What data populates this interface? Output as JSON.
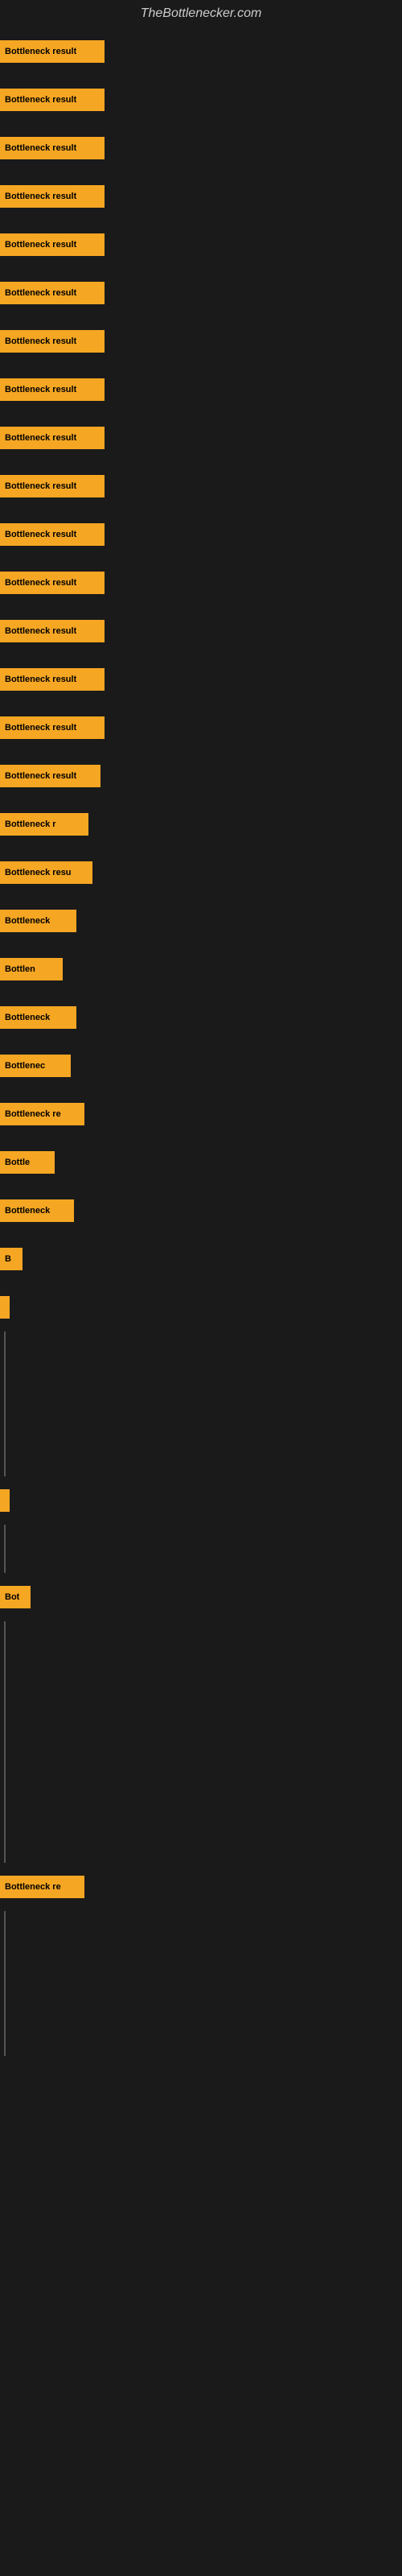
{
  "site": {
    "title": "TheBottlenecker.com"
  },
  "bars": [
    {
      "label": "Bottleneck result",
      "width": 130,
      "visible": true
    },
    {
      "label": "Bottleneck result",
      "width": 130,
      "visible": true
    },
    {
      "label": "Bottleneck result",
      "width": 130,
      "visible": true
    },
    {
      "label": "Bottleneck result",
      "width": 130,
      "visible": true
    },
    {
      "label": "Bottleneck result",
      "width": 130,
      "visible": true
    },
    {
      "label": "Bottleneck result",
      "width": 130,
      "visible": true
    },
    {
      "label": "Bottleneck result",
      "width": 130,
      "visible": true
    },
    {
      "label": "Bottleneck result",
      "width": 130,
      "visible": true
    },
    {
      "label": "Bottleneck result",
      "width": 130,
      "visible": true
    },
    {
      "label": "Bottleneck result",
      "width": 130,
      "visible": true
    },
    {
      "label": "Bottleneck result",
      "width": 130,
      "visible": true
    },
    {
      "label": "Bottleneck result",
      "width": 130,
      "visible": true
    },
    {
      "label": "Bottleneck result",
      "width": 130,
      "visible": true
    },
    {
      "label": "Bottleneck result",
      "width": 130,
      "visible": true
    },
    {
      "label": "Bottleneck result",
      "width": 130,
      "visible": true
    },
    {
      "label": "Bottleneck result",
      "width": 125,
      "visible": true
    },
    {
      "label": "Bottleneck r",
      "width": 110,
      "visible": true
    },
    {
      "label": "Bottleneck resu",
      "width": 115,
      "visible": true
    },
    {
      "label": "Bottleneck",
      "width": 95,
      "visible": true
    },
    {
      "label": "Bottlen",
      "width": 78,
      "visible": true
    },
    {
      "label": "Bottleneck",
      "width": 95,
      "visible": true
    },
    {
      "label": "Bottlenec",
      "width": 88,
      "visible": true
    },
    {
      "label": "Bottleneck re",
      "width": 105,
      "visible": true
    },
    {
      "label": "Bottle",
      "width": 68,
      "visible": true
    },
    {
      "label": "Bottleneck",
      "width": 92,
      "visible": true
    },
    {
      "label": "B",
      "width": 28,
      "visible": true
    },
    {
      "label": "",
      "width": 8,
      "visible": true
    },
    {
      "label": "",
      "width": 0,
      "visible": false
    },
    {
      "label": "",
      "width": 0,
      "visible": false
    },
    {
      "label": "",
      "width": 0,
      "visible": false
    },
    {
      "label": "",
      "width": 2,
      "visible": true
    },
    {
      "label": "",
      "width": 0,
      "visible": false
    },
    {
      "label": "Bot",
      "width": 38,
      "visible": true
    },
    {
      "label": "",
      "width": 0,
      "visible": false
    },
    {
      "label": "",
      "width": 0,
      "visible": false
    },
    {
      "label": "",
      "width": 0,
      "visible": false
    },
    {
      "label": "",
      "width": 0,
      "visible": false
    },
    {
      "label": "",
      "width": 0,
      "visible": false
    },
    {
      "label": "Bottleneck re",
      "width": 105,
      "visible": true
    },
    {
      "label": "",
      "width": 0,
      "visible": false
    },
    {
      "label": "",
      "width": 0,
      "visible": false
    },
    {
      "label": "",
      "width": 0,
      "visible": false
    }
  ]
}
